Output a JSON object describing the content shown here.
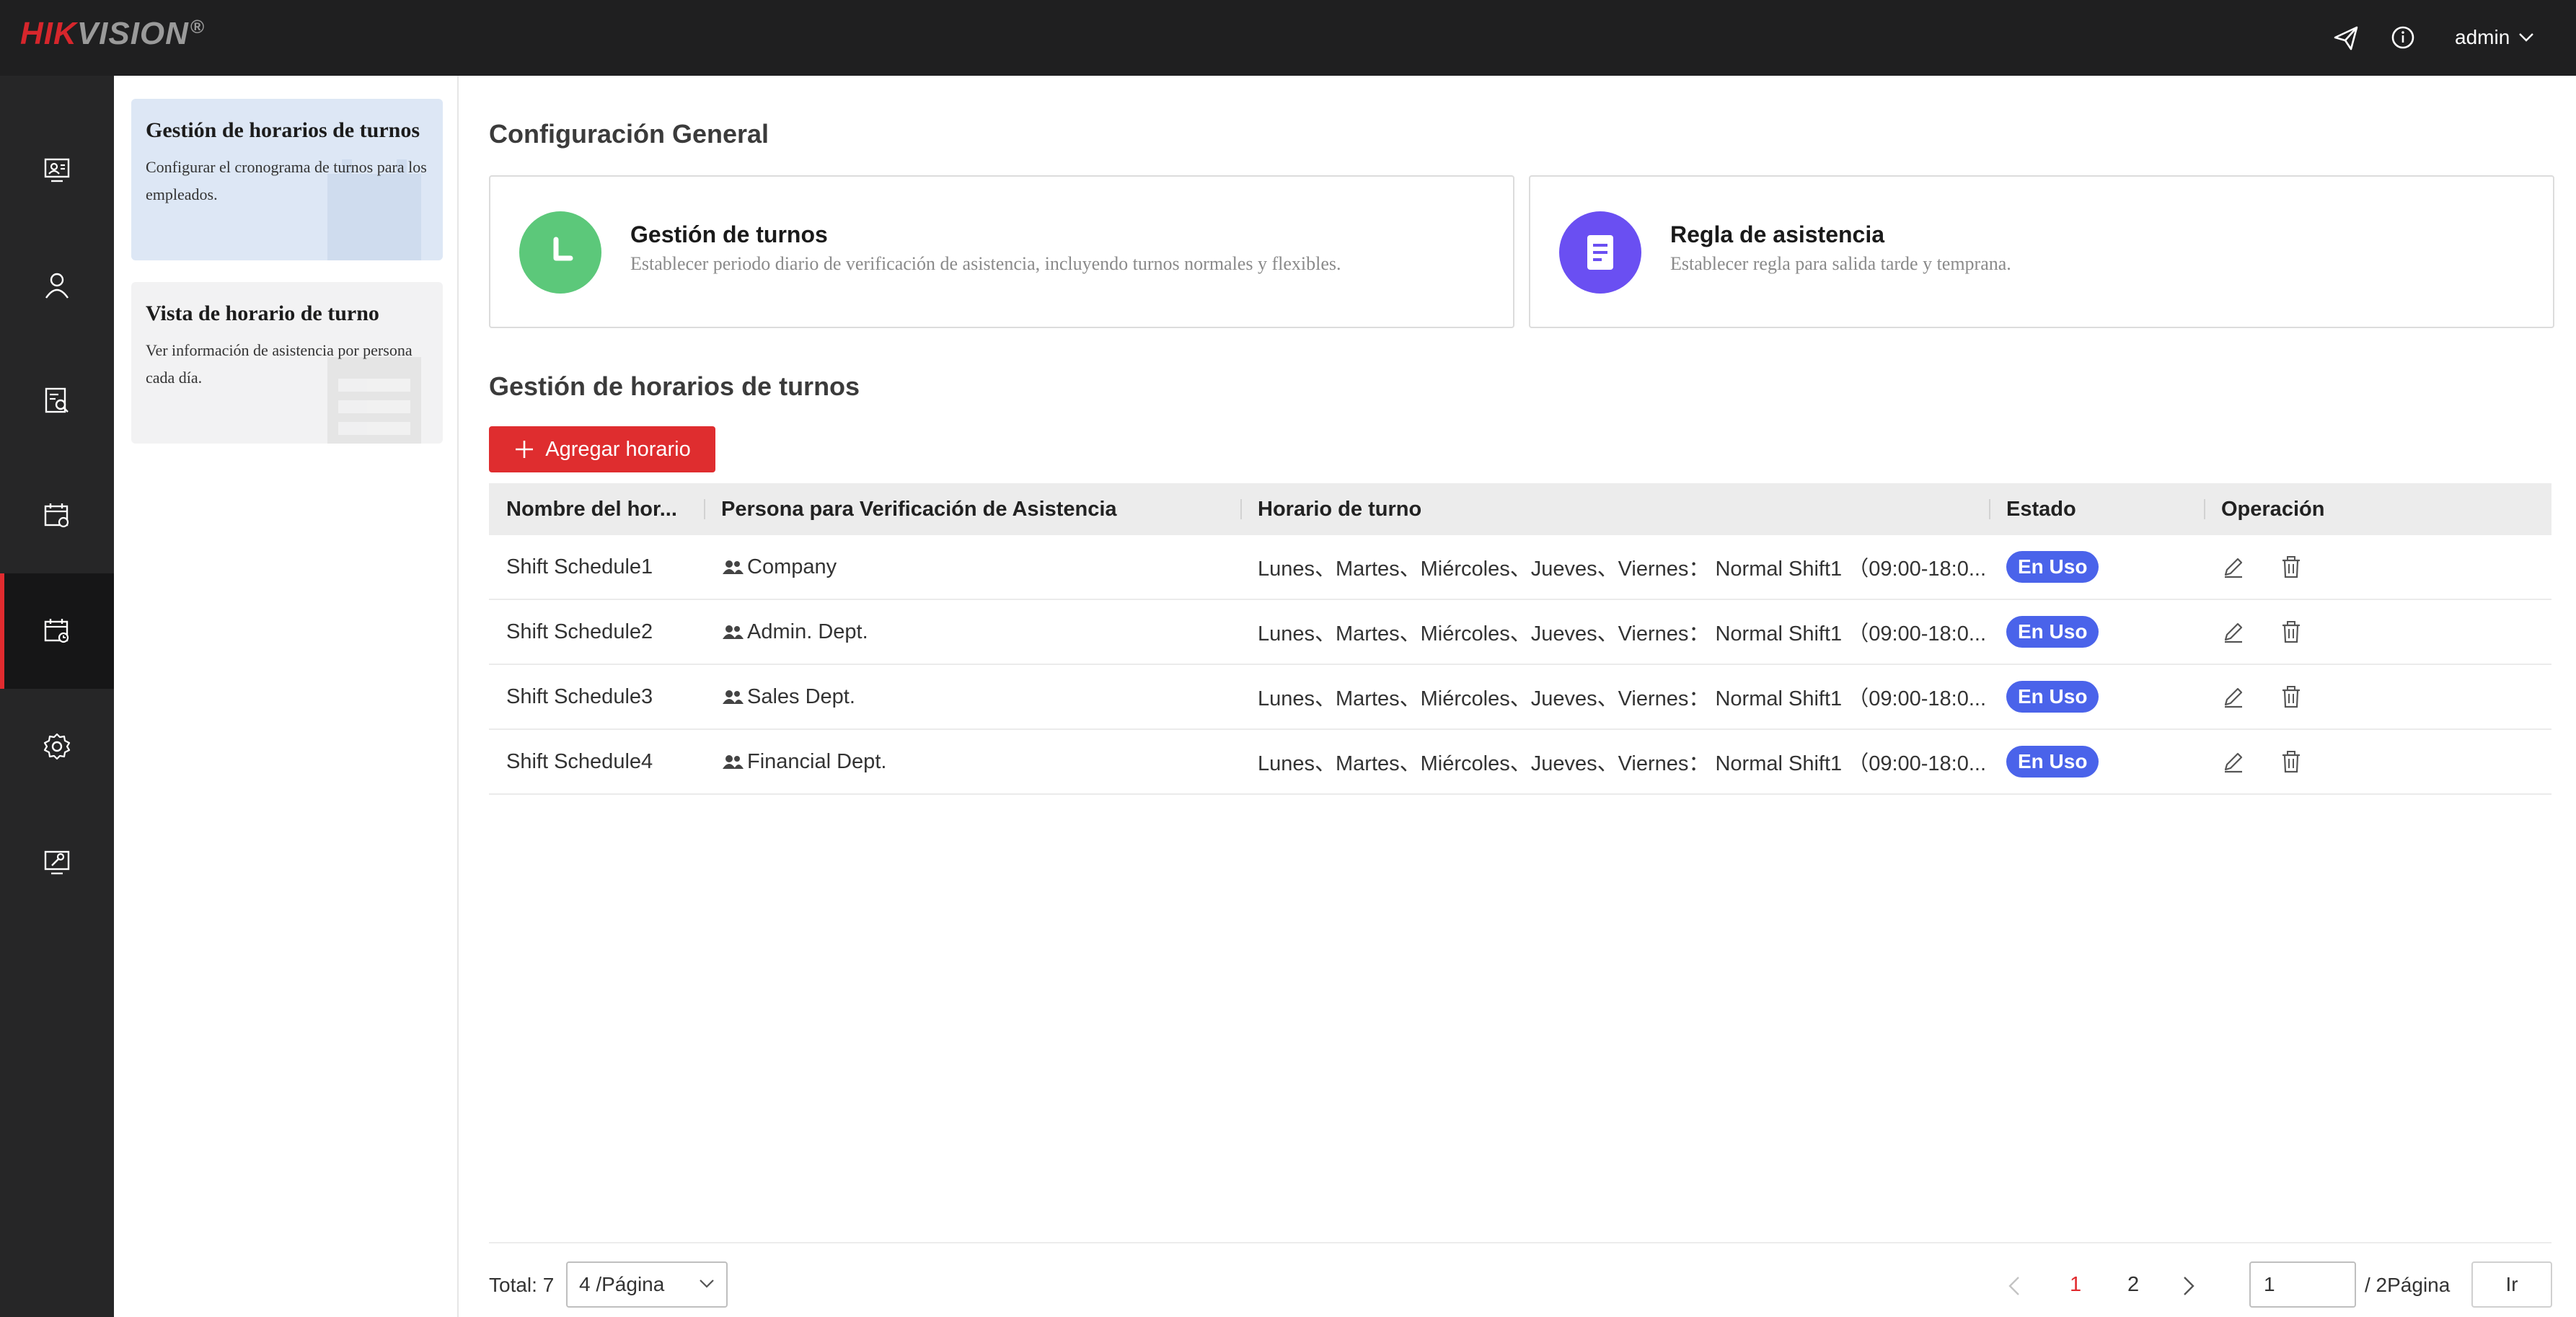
{
  "header": {
    "logo_main": "HIK",
    "logo_rest": "VISION",
    "logo_reg": "®",
    "user": "admin"
  },
  "icons": {
    "send": "send-icon",
    "info": "info-icon",
    "chevron": "chevron-down-icon"
  },
  "nav": {
    "items": [
      {
        "name": "monitor-person-icon"
      },
      {
        "name": "person-icon"
      },
      {
        "name": "search-report-icon"
      },
      {
        "name": "calendar-settings-icon"
      },
      {
        "name": "calendar-schedule-icon",
        "active": true
      },
      {
        "name": "gear-icon"
      },
      {
        "name": "maintenance-icon"
      }
    ]
  },
  "sidebar": {
    "cards": [
      {
        "title": "Gestión de horarios de turnos",
        "desc": "Configurar el cronograma de turnos para los empleados."
      },
      {
        "title": "Vista de horario de turno",
        "desc": "Ver información de asistencia por persona cada día."
      }
    ]
  },
  "main": {
    "config_title": "Configuración General",
    "features": [
      {
        "title": "Gestión de turnos",
        "desc": "Establecer periodo diario de verificación de asistencia, incluyendo turnos normales y flexibles.",
        "color": "#5cc87a"
      },
      {
        "title": "Regla de asistencia",
        "desc": "Establecer regla para salida tarde y temprana.",
        "color": "#6a4ff2"
      }
    ],
    "schedule_title": "Gestión de horarios de turnos",
    "add_button": "Agregar horario",
    "table": {
      "headers": [
        "Nombre del hor...",
        "Persona para Verificación de Asistencia",
        "Horario de turno",
        "Estado",
        "Operación"
      ],
      "rows": [
        {
          "name": "Shift Schedule1",
          "person": "Company",
          "schedule": "Lunes、Martes、Miércoles、Jueves、Viernes： Normal Shift1 （09:00-18:0...",
          "status": "En Uso"
        },
        {
          "name": "Shift Schedule2",
          "person": "Admin. Dept.",
          "schedule": "Lunes、Martes、Miércoles、Jueves、Viernes： Normal Shift1 （09:00-18:0...",
          "status": "En Uso"
        },
        {
          "name": "Shift Schedule3",
          "person": "Sales Dept.",
          "schedule": "Lunes、Martes、Miércoles、Jueves、Viernes： Normal Shift1 （09:00-18:0...",
          "status": "En Uso"
        },
        {
          "name": "Shift Schedule4",
          "person": "Financial Dept.",
          "schedule": "Lunes、Martes、Miércoles、Jueves、Viernes： Normal Shift1 （09:00-18:0...",
          "status": "En Uso"
        }
      ]
    }
  },
  "pagination": {
    "total": "Total: 7",
    "per_page": "4 /Página",
    "pages": [
      "1",
      "2"
    ],
    "current_page": "1",
    "page_input": "1",
    "of_pages": "/ 2Página",
    "go": "Ir"
  },
  "colors": {
    "accent": "#e12b2f",
    "badge": "#4a63ea",
    "topbar": "#1f1f20"
  }
}
